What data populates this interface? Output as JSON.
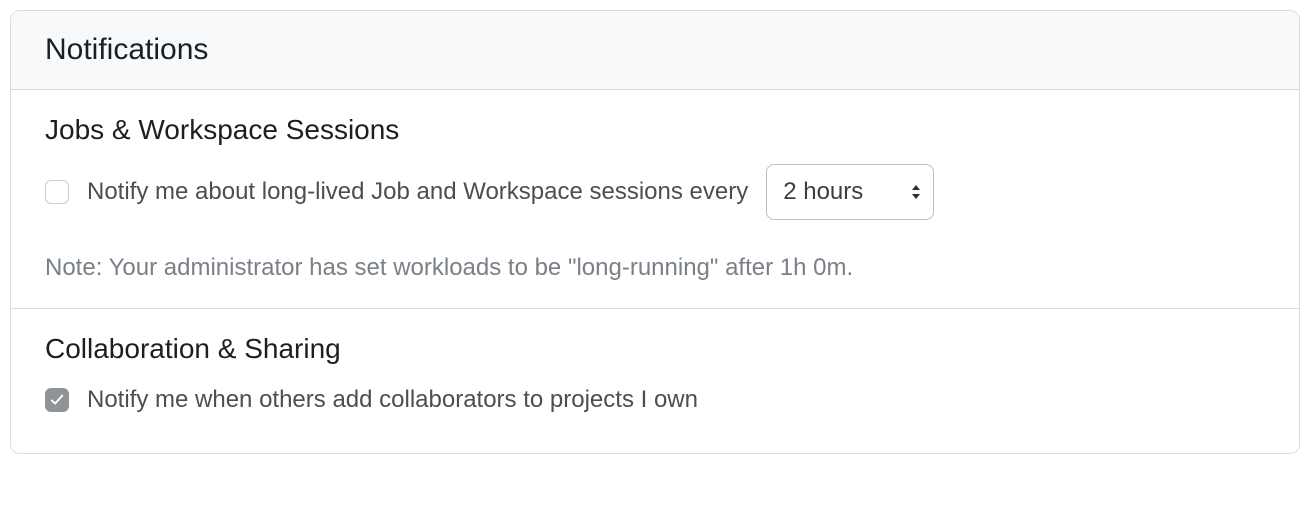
{
  "panel": {
    "title": "Notifications"
  },
  "sections": {
    "jobs": {
      "title": "Jobs & Workspace Sessions",
      "checkbox_checked": false,
      "label": "Notify me about long-lived Job and Workspace sessions every",
      "select_value": "2 hours",
      "note": "Note: Your administrator has set workloads to be \"long-running\" after 1h 0m."
    },
    "collab": {
      "title": "Collaboration & Sharing",
      "checkbox_checked": true,
      "label": "Notify me when others add collaborators to projects I own"
    }
  }
}
